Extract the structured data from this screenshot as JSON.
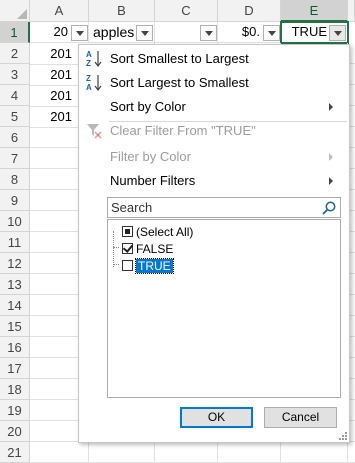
{
  "sheet": {
    "columns": [
      "A",
      "B",
      "C",
      "D",
      "E"
    ],
    "active_column": "E",
    "rows": [
      "1",
      "2",
      "3",
      "4",
      "5",
      "6",
      "7",
      "8",
      "9",
      "10",
      "11",
      "12",
      "13",
      "14",
      "15",
      "16",
      "17",
      "18",
      "19",
      "20",
      "21"
    ],
    "active_row": "1",
    "header_row": {
      "a": "20",
      "b": "apples",
      "d": "$0.",
      "e": "TRUE"
    },
    "col_a_values": [
      "201",
      "201",
      "201",
      "201"
    ]
  },
  "filter_menu": {
    "sort_asc": "Sort Smallest to Largest",
    "sort_desc": "Sort Largest to Smallest",
    "sort_by_color": "Sort by Color",
    "clear_filter": "Clear Filter From \"TRUE\"",
    "filter_by_color": "Filter by Color",
    "number_filters": "Number Filters",
    "search_placeholder": "Search",
    "items": [
      {
        "label": "(Select All)",
        "state": "indeterminate"
      },
      {
        "label": "FALSE",
        "state": "checked"
      },
      {
        "label": "TRUE",
        "state": "unchecked",
        "selected": true
      }
    ],
    "ok_label": "OK",
    "cancel_label": "Cancel"
  },
  "colors": {
    "accent": "#217346",
    "selection": "#0078d7"
  }
}
